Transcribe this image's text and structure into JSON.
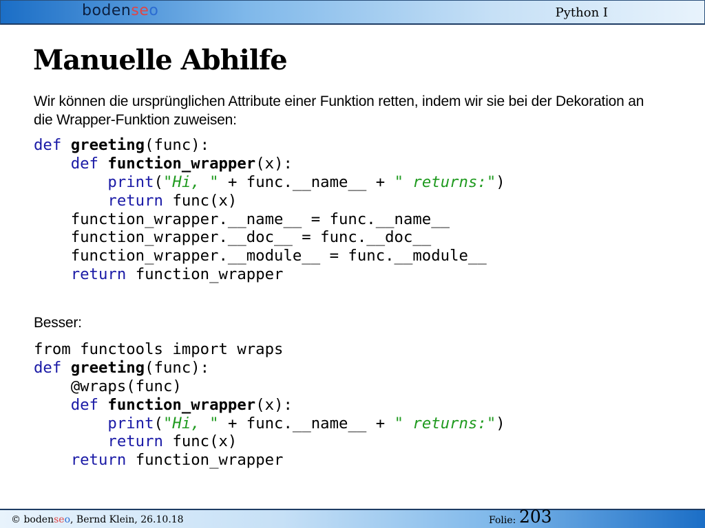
{
  "header": {
    "logo": {
      "main": "boden",
      "s": "se",
      "o": "o"
    },
    "course": "Python I"
  },
  "slide": {
    "title": "Manuelle Abhilfe",
    "intro": "Wir können die ursprünglichen Attribute einer Funktion retten, indem wir sie bei der Dekoration an die Wrapper-Funktion zuweisen:",
    "better_label": "Besser:"
  },
  "code1": {
    "def": "def",
    "greeting": "greeting",
    "paren_func": "(func):",
    "def2": "def",
    "function_wrapper": "function_wrapper",
    "paren_x": "(x):",
    "print": "print",
    "print_open": "(",
    "str1": "\"Hi, \"",
    "concat": " + func.__name__ + ",
    "str2": "\" returns:\"",
    "print_close": ")",
    "return": "return",
    "return_val": "func(x)",
    "line5": "function_wrapper.__name__ = func.__name__",
    "line6": "function_wrapper.__doc__ = func.__doc__",
    "line7": "function_wrapper.__module__ = func.__module__",
    "return2": "return",
    "return2_val": "function_wrapper"
  },
  "code2": {
    "import_line": "from functools import wraps",
    "def": "def",
    "greeting": "greeting",
    "paren_func": "(func):",
    "decorator": "@wraps(func)",
    "def2": "def",
    "function_wrapper": "function_wrapper",
    "paren_x": "(x):",
    "print": "print",
    "print_open": "(",
    "str1": "\"Hi, \"",
    "concat": " + func.__name__ + ",
    "str2": "\" returns:\"",
    "print_close": ")",
    "return": "return",
    "return_val": "func(x)",
    "return2": "return",
    "return2_val": "function_wrapper"
  },
  "footer": {
    "copy_prefix": "© ",
    "logo": {
      "main": "boden",
      "s": "se",
      "o": "o"
    },
    "author": ", Bernd Klein, 26.10.18",
    "folie_label": "Folie:",
    "folie_number": "203"
  },
  "colors": {
    "keyword": "#1a1aa6",
    "string": "#1f9a1f",
    "logo_red": "#e04545",
    "logo_blue": "#2b6cd1",
    "header_dark": "#1b6ec6",
    "header_light": "#e8f3fc"
  }
}
